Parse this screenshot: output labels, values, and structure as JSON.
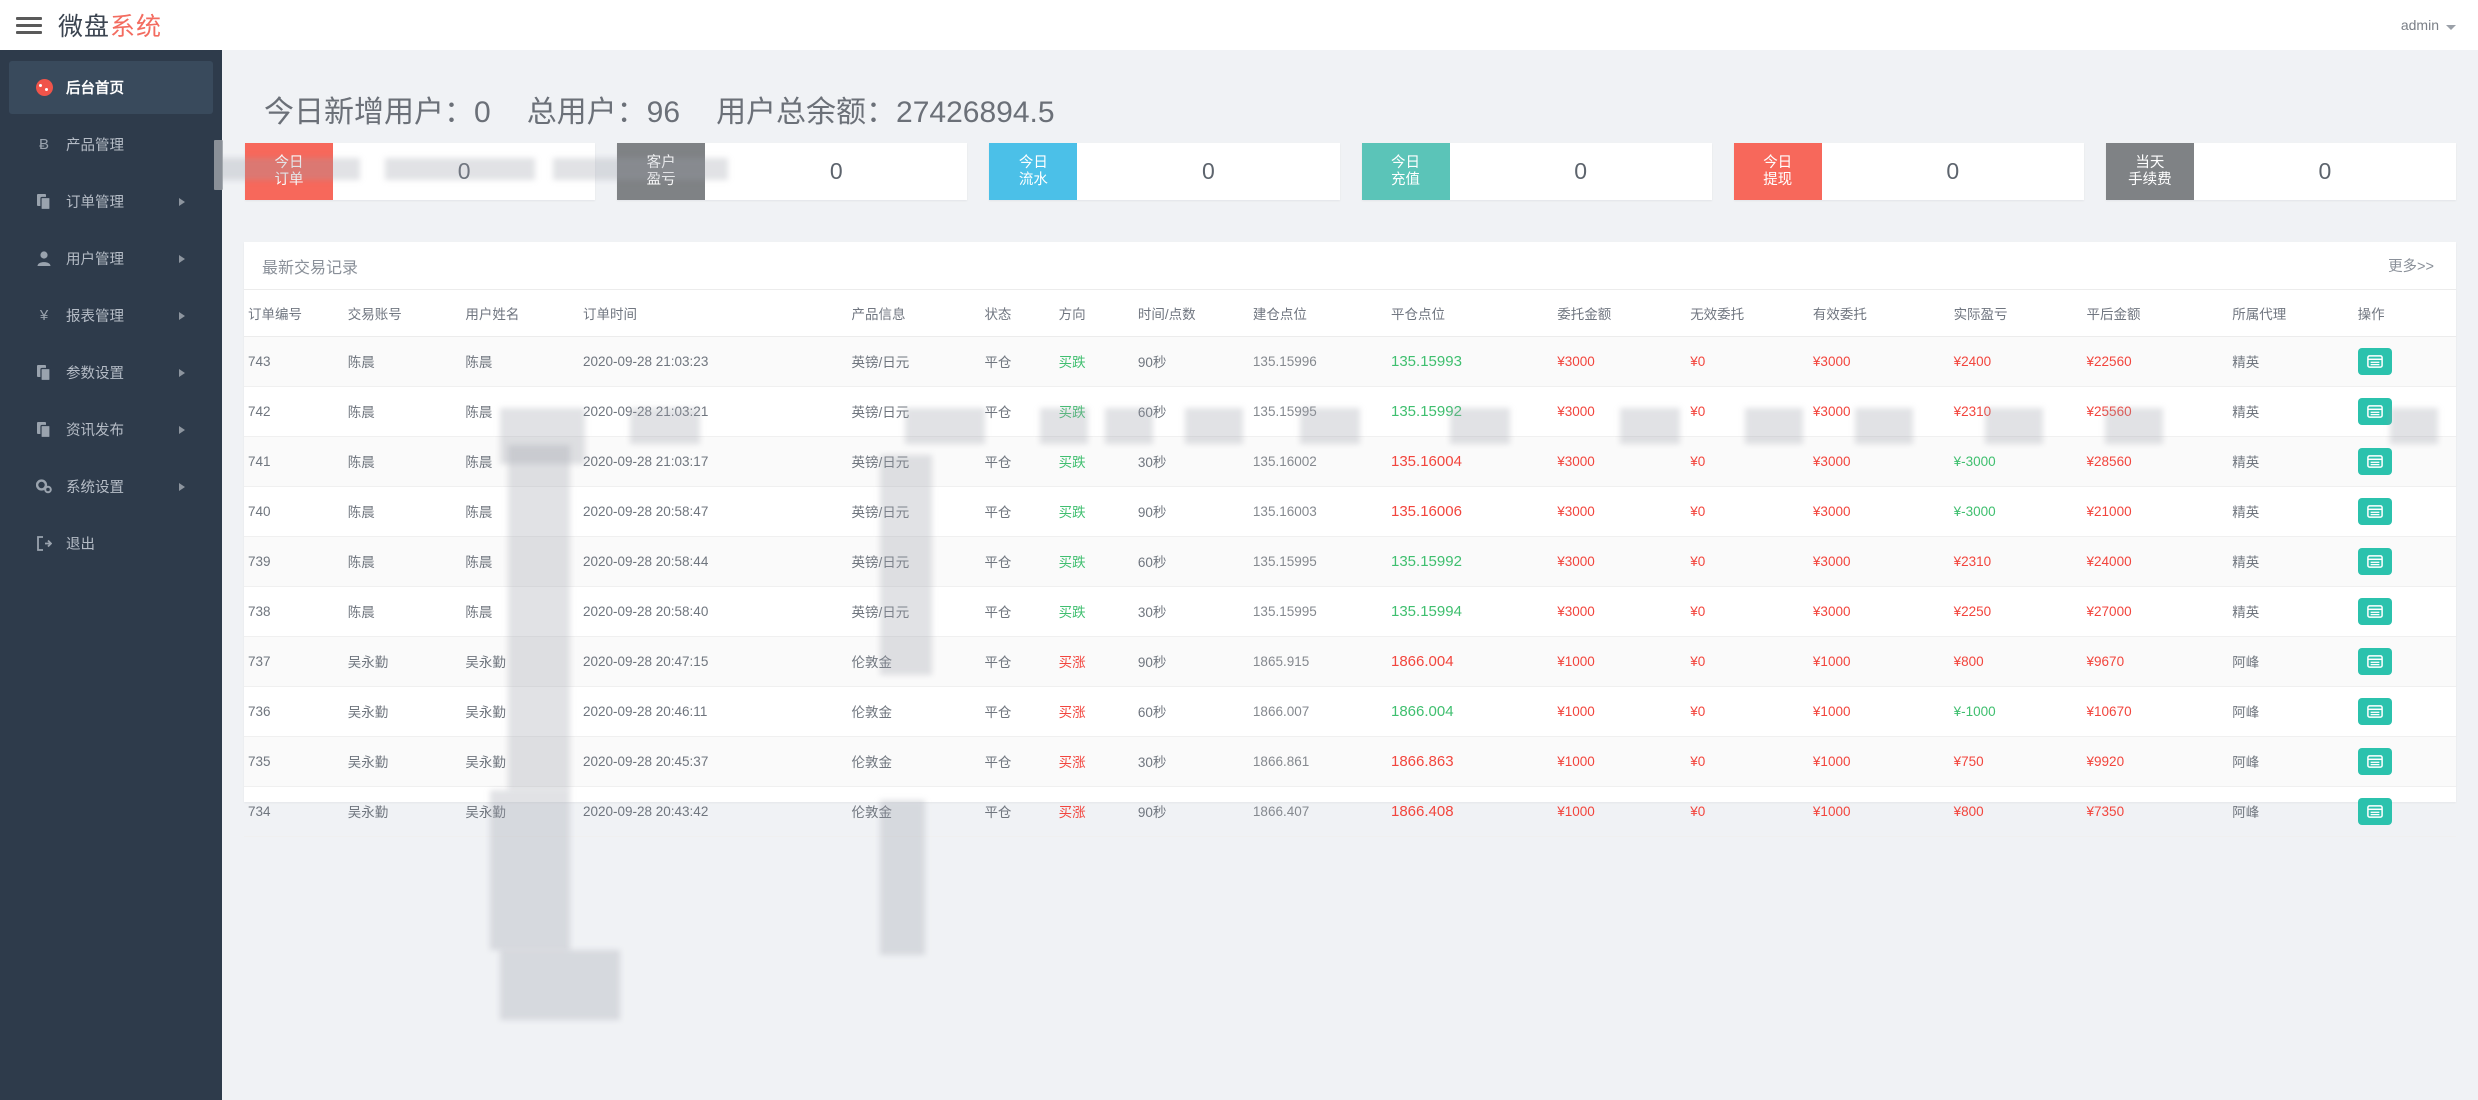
{
  "topbar": {
    "menu_icon": "hamburger-icon",
    "brand_part1": "微盘",
    "brand_part2": "系统",
    "user_label": "admin",
    "user_caret": "chevron-down-icon"
  },
  "sidebar": {
    "items": [
      {
        "label": "后台首页",
        "icon": "dashboard-icon",
        "active": true,
        "arrow": false
      },
      {
        "label": "产品管理",
        "icon": "bitcoin-icon",
        "active": false,
        "arrow": false
      },
      {
        "label": "订单管理",
        "icon": "files-icon",
        "active": false,
        "arrow": true
      },
      {
        "label": "用户管理",
        "icon": "user-icon",
        "active": false,
        "arrow": true
      },
      {
        "label": "报表管理",
        "icon": "yen-icon",
        "active": false,
        "arrow": true
      },
      {
        "label": "参数设置",
        "icon": "files-icon",
        "active": false,
        "arrow": true
      },
      {
        "label": "资讯发布",
        "icon": "files-icon",
        "active": false,
        "arrow": true
      },
      {
        "label": "系统设置",
        "icon": "gear-icon",
        "active": false,
        "arrow": true
      },
      {
        "label": "退出",
        "icon": "logout-icon",
        "active": false,
        "arrow": false
      }
    ]
  },
  "headline": {
    "new_users": "今日新增用户：0",
    "total_users": "总用户：96",
    "total_balance": "用户总余额：27426894.5"
  },
  "cards": [
    {
      "label_line1": "今日",
      "label_line2": "订单",
      "value": "0",
      "color": "#f7685b"
    },
    {
      "label_line1": "客户",
      "label_line2": "盈亏",
      "value": "0",
      "color": "#7f8285"
    },
    {
      "label_line1": "今日",
      "label_line2": "流水",
      "value": "0",
      "color": "#4bc0e8"
    },
    {
      "label_line1": "今日",
      "label_line2": "充值",
      "value": "0",
      "color": "#5bc4b8"
    },
    {
      "label_line1": "今日",
      "label_line2": "提现",
      "value": "0",
      "color": "#f7685b"
    },
    {
      "label_line1": "当天",
      "label_line2": "手续费",
      "value": "0",
      "color": "#7f8285"
    }
  ],
  "panel": {
    "title": "最新交易记录",
    "more_label": "更多>>",
    "columns": [
      "订单编号",
      "交易账号",
      "用户姓名",
      "订单时间",
      "产品信息",
      "状态",
      "方向",
      "时间/点数",
      "建仓点位",
      "平仓点位",
      "委托金额",
      "无效委托",
      "有效委托",
      "实际盈亏",
      "平后金额",
      "所属代理",
      "操作"
    ],
    "op_icon": "record-card-icon",
    "rows": [
      {
        "id": "743",
        "account": "陈晨",
        "name": "陈晨",
        "time": "2020-09-28 21:03:23",
        "product": "英镑/日元",
        "status": "平仓",
        "direction": "买跌",
        "dir_color": "green",
        "duration": "90秒",
        "open": "135.15996",
        "close": "135.15993",
        "close_color": "green",
        "amount": "¥3000",
        "invalid": "¥0",
        "valid": "¥3000",
        "pl": "¥2400",
        "pl_neg": false,
        "balance": "¥22560",
        "agent": "精英"
      },
      {
        "id": "742",
        "account": "陈晨",
        "name": "陈晨",
        "time": "2020-09-28 21:03:21",
        "product": "英镑/日元",
        "status": "平仓",
        "direction": "买跌",
        "dir_color": "green",
        "duration": "60秒",
        "open": "135.15995",
        "close": "135.15992",
        "close_color": "green",
        "amount": "¥3000",
        "invalid": "¥0",
        "valid": "¥3000",
        "pl": "¥2310",
        "pl_neg": false,
        "balance": "¥25560",
        "agent": "精英"
      },
      {
        "id": "741",
        "account": "陈晨",
        "name": "陈晨",
        "time": "2020-09-28 21:03:17",
        "product": "英镑/日元",
        "status": "平仓",
        "direction": "买跌",
        "dir_color": "green",
        "duration": "30秒",
        "open": "135.16002",
        "close": "135.16004",
        "close_color": "red",
        "amount": "¥3000",
        "invalid": "¥0",
        "valid": "¥3000",
        "pl": "¥-3000",
        "pl_neg": true,
        "balance": "¥28560",
        "agent": "精英"
      },
      {
        "id": "740",
        "account": "陈晨",
        "name": "陈晨",
        "time": "2020-09-28 20:58:47",
        "product": "英镑/日元",
        "status": "平仓",
        "direction": "买跌",
        "dir_color": "green",
        "duration": "90秒",
        "open": "135.16003",
        "close": "135.16006",
        "close_color": "red",
        "amount": "¥3000",
        "invalid": "¥0",
        "valid": "¥3000",
        "pl": "¥-3000",
        "pl_neg": true,
        "balance": "¥21000",
        "agent": "精英"
      },
      {
        "id": "739",
        "account": "陈晨",
        "name": "陈晨",
        "time": "2020-09-28 20:58:44",
        "product": "英镑/日元",
        "status": "平仓",
        "direction": "买跌",
        "dir_color": "green",
        "duration": "60秒",
        "open": "135.15995",
        "close": "135.15992",
        "close_color": "green",
        "amount": "¥3000",
        "invalid": "¥0",
        "valid": "¥3000",
        "pl": "¥2310",
        "pl_neg": false,
        "balance": "¥24000",
        "agent": "精英"
      },
      {
        "id": "738",
        "account": "陈晨",
        "name": "陈晨",
        "time": "2020-09-28 20:58:40",
        "product": "英镑/日元",
        "status": "平仓",
        "direction": "买跌",
        "dir_color": "green",
        "duration": "30秒",
        "open": "135.15995",
        "close": "135.15994",
        "close_color": "green",
        "amount": "¥3000",
        "invalid": "¥0",
        "valid": "¥3000",
        "pl": "¥2250",
        "pl_neg": false,
        "balance": "¥27000",
        "agent": "精英"
      },
      {
        "id": "737",
        "account": "吴永勤",
        "name": "吴永勤",
        "time": "2020-09-28 20:47:15",
        "product": "伦敦金",
        "status": "平仓",
        "direction": "买涨",
        "dir_color": "red",
        "duration": "90秒",
        "open": "1865.915",
        "close": "1866.004",
        "close_color": "red",
        "amount": "¥1000",
        "invalid": "¥0",
        "valid": "¥1000",
        "pl": "¥800",
        "pl_neg": false,
        "balance": "¥9670",
        "agent": "阿峰"
      },
      {
        "id": "736",
        "account": "吴永勤",
        "name": "吴永勤",
        "time": "2020-09-28 20:46:11",
        "product": "伦敦金",
        "status": "平仓",
        "direction": "买涨",
        "dir_color": "red",
        "duration": "60秒",
        "open": "1866.007",
        "close": "1866.004",
        "close_color": "green",
        "amount": "¥1000",
        "invalid": "¥0",
        "valid": "¥1000",
        "pl": "¥-1000",
        "pl_neg": true,
        "balance": "¥10670",
        "agent": "阿峰"
      },
      {
        "id": "735",
        "account": "吴永勤",
        "name": "吴永勤",
        "time": "2020-09-28 20:45:37",
        "product": "伦敦金",
        "status": "平仓",
        "direction": "买涨",
        "dir_color": "red",
        "duration": "30秒",
        "open": "1866.861",
        "close": "1866.863",
        "close_color": "red",
        "amount": "¥1000",
        "invalid": "¥0",
        "valid": "¥1000",
        "pl": "¥750",
        "pl_neg": false,
        "balance": "¥9920",
        "agent": "阿峰"
      },
      {
        "id": "734",
        "account": "吴永勤",
        "name": "吴永勤",
        "time": "2020-09-28 20:43:42",
        "product": "伦敦金",
        "status": "平仓",
        "direction": "买涨",
        "dir_color": "red",
        "duration": "90秒",
        "open": "1866.407",
        "close": "1866.408",
        "close_color": "red",
        "amount": "¥1000",
        "invalid": "¥0",
        "valid": "¥1000",
        "pl": "¥800",
        "pl_neg": false,
        "balance": "¥7350",
        "agent": "阿峰"
      }
    ]
  }
}
